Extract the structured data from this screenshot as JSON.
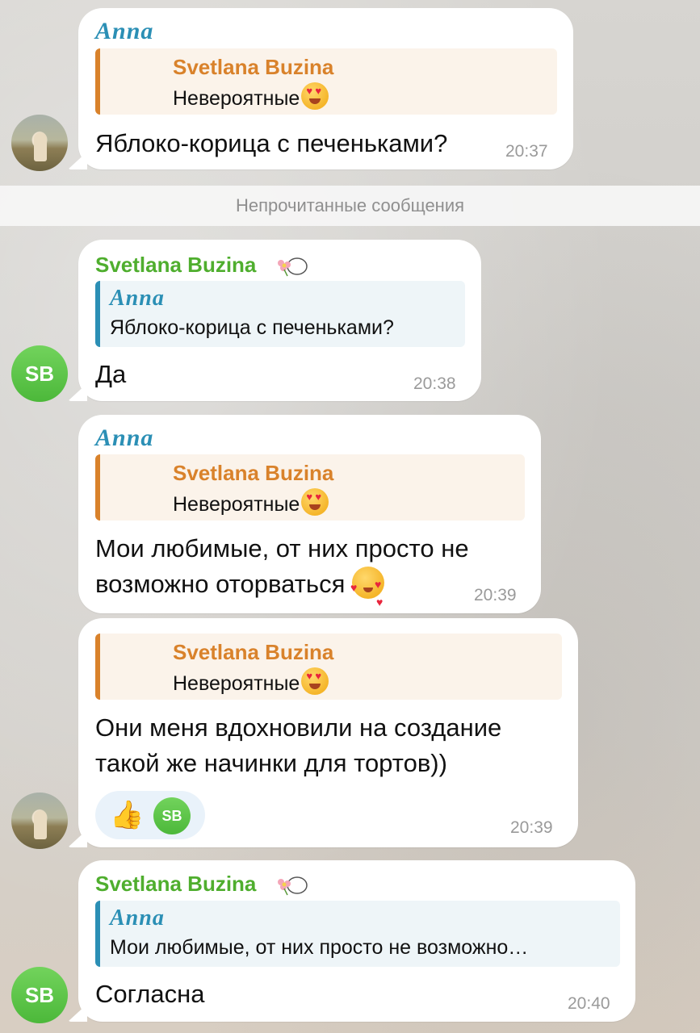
{
  "unread_divider": "Непрочитанные сообщения",
  "messages": [
    {
      "sender": "Anna",
      "reply_name": "Svetlana Buzina",
      "reply_text": "Невероятные",
      "text": "Яблоко-корица с печеньками?",
      "time": "20:37"
    },
    {
      "sender": "Svetlana Buzina",
      "reply_name": "Anna",
      "reply_text": "Яблоко-корица с печеньками?",
      "text": "Да",
      "time": "20:38",
      "avatar": "SB"
    },
    {
      "sender": "Anna",
      "reply_name": "Svetlana Buzina",
      "reply_text": "Невероятные",
      "text_line1": "Мои любимые, от них просто не",
      "text_line2": "возможно оторваться",
      "time": "20:39"
    },
    {
      "reply_name": "Svetlana Buzina",
      "reply_text": "Невероятные",
      "text_line1": "Они меня вдохновили на создание",
      "text_line2": "такой же начинки для тортов))",
      "time": "20:39",
      "reaction_avatar": "SB"
    },
    {
      "sender": "Svetlana Buzina",
      "reply_name": "Anna",
      "reply_text": "Мои любимые, от них просто не возможно…",
      "text": "Согласна",
      "time": "20:40",
      "avatar": "SB"
    }
  ],
  "colors": {
    "anna": "#2b8fb5",
    "svetlana": "#4fae2e",
    "reply_orange": "#d9822b",
    "time": "#9a9a9a"
  }
}
